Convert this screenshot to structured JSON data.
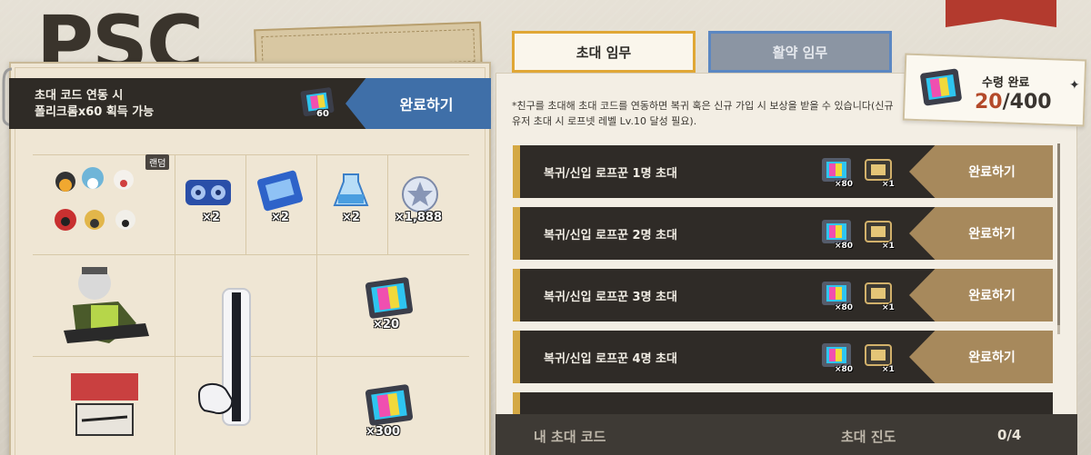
{
  "header": {
    "top_text": "",
    "logo_text": "PSC"
  },
  "invite_banner": {
    "line1": "초대 코드 연동 시",
    "line2": "폴리크롬x60 획득 가능",
    "reward_qty": "60",
    "button_label": "완료하기"
  },
  "rewards_grid": {
    "random_tag": "랜덤",
    "row1": [
      {
        "name": "tape-reel",
        "qty": "×2"
      },
      {
        "name": "blue-card",
        "qty": "×2"
      },
      {
        "name": "blue-vial",
        "qty": "×2"
      },
      {
        "name": "coin",
        "qty": "×1,888"
      }
    ],
    "polychrome_qty_1": "×20",
    "polychrome_qty_2": "×300"
  },
  "tabs": [
    {
      "label": "초대 임무",
      "active": true
    },
    {
      "label": "활약 임무",
      "active": false
    }
  ],
  "note": "*친구를 초대해 초대 코드를 연동하면 복귀 혹은 신규 가입 시 보상을 받을 수 있습니다(신규 유저 초대 시 로프넷 레벨 Lv.10 달성 필요).",
  "progress": {
    "label": "수령 완료",
    "current": "20",
    "total": "/400"
  },
  "missions": [
    {
      "label": "복귀/신입 로프꾼 1명 초대",
      "reward1": "×80",
      "reward2": "×1",
      "button": "완료하기"
    },
    {
      "label": "복귀/신입 로프꾼 2명 초대",
      "reward1": "×80",
      "reward2": "×1",
      "button": "완료하기"
    },
    {
      "label": "복귀/신입 로프꾼 3명 초대",
      "reward1": "×80",
      "reward2": "×1",
      "button": "완료하기"
    },
    {
      "label": "복귀/신입 로프꾼 4명 초대",
      "reward1": "×80",
      "reward2": "×1",
      "button": "완료하기"
    }
  ],
  "bottom": {
    "my_code_label": "내 초대 코드",
    "progress_label": "초대 진도",
    "progress_value": "0/4"
  },
  "colors": {
    "accent_gold": "#d4a844",
    "button_blue": "#3f6fa8",
    "button_tan": "#a7895c",
    "dark_bar": "#2f2b27",
    "progress_red": "#b44a2a"
  }
}
